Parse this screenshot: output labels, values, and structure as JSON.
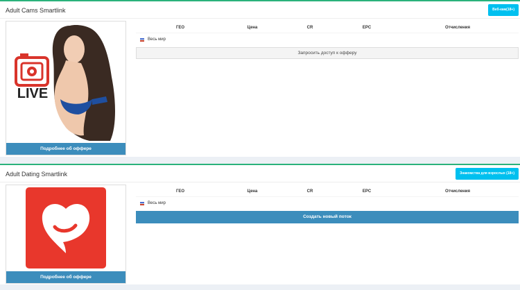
{
  "offers": [
    {
      "title": "Adult Cams Smartlink",
      "category_tag": "Веб-кам(18+)",
      "thumbnail_text": "LIVE",
      "details_button": "Подробнее об оффере",
      "table_headers": [
        "ГЕО",
        "Цена",
        "CR",
        "EPC",
        "Отчисления"
      ],
      "geo": "Весь мир",
      "action_button": "Запросить доступ к офферу"
    },
    {
      "title": "Adult Dating Smartlink",
      "category_tag": "Знакомства для взрослых (18+)",
      "details_button": "Подробнее об оффере",
      "table_headers": [
        "ГЕО",
        "Цена",
        "CR",
        "EPC",
        "Отчисления"
      ],
      "geo": "Весь мир",
      "action_button": "Создать новый поток"
    }
  ],
  "colors": {
    "accent_green": "#2ab27b",
    "tag_cyan": "#00c0ef",
    "primary_blue": "#3c8dbc",
    "live_red": "#d9342b",
    "dating_red": "#e8372c"
  },
  "icons": {
    "live_logo": "camera-live-icon",
    "dating_logo": "heart-smile-icon",
    "world_flag": "flag-icon"
  }
}
